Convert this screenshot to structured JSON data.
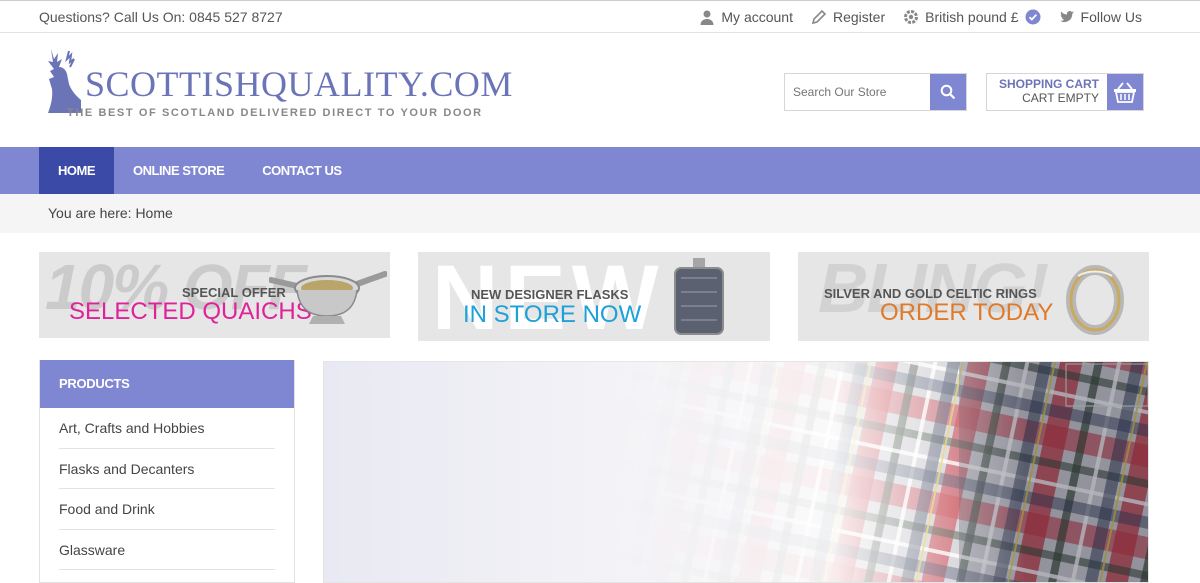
{
  "topbar": {
    "phone": "Questions? Call Us On: 0845 527 8727",
    "account": "My account",
    "register": "Register",
    "currency": "British pound £",
    "follow": "Follow Us"
  },
  "logo": {
    "title": "SCOTTISHQUALITY.COM",
    "tagline": "THE BEST OF SCOTLAND DELIVERED DIRECT TO YOUR DOOR"
  },
  "search": {
    "placeholder": "Search Our Store"
  },
  "cart": {
    "title": "SHOPPING CART",
    "status": "CART EMPTY"
  },
  "nav": {
    "items": [
      {
        "label": "HOME"
      },
      {
        "label": "ONLINE STORE"
      },
      {
        "label": "CONTACT US"
      }
    ]
  },
  "breadcrumb": {
    "text": "You are here: Home"
  },
  "banners": [
    {
      "bg": "10% OFF",
      "small": "SPECIAL OFFER",
      "big": "SELECTED QUAICHS"
    },
    {
      "bg": "NEW",
      "small": "NEW DESIGNER FLASKS",
      "big": "IN STORE NOW"
    },
    {
      "bg": "BLING!",
      "small": "SILVER AND GOLD CELTIC RINGS",
      "big": "ORDER TODAY"
    }
  ],
  "sidebar": {
    "heading": "PRODUCTS",
    "items": [
      {
        "label": "Art, Crafts and Hobbies"
      },
      {
        "label": "Flasks and Decanters"
      },
      {
        "label": "Food and Drink"
      },
      {
        "label": "Glassware"
      }
    ]
  },
  "colors": {
    "accent": "#7f87d3",
    "nav_active": "#3b4aa6",
    "magenta": "#e0219a",
    "blue": "#1da1d8",
    "orange": "#e07a2a"
  }
}
